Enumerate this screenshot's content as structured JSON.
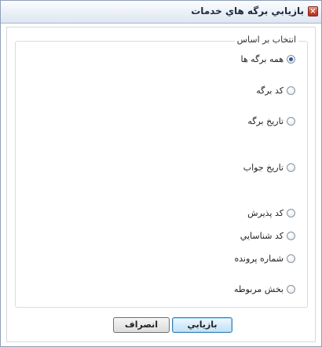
{
  "window": {
    "title": "بازيابي برگه هاي خدمات",
    "close_glyph": "×"
  },
  "group": {
    "legend": "انتخاب بر اساس",
    "options": [
      {
        "label": "همه برگه ها",
        "checked": true
      },
      {
        "label": "کد برگه",
        "checked": false
      },
      {
        "label": "تاريخ برگه",
        "checked": false
      },
      {
        "label": "تاريخ جواب",
        "checked": false
      },
      {
        "label": "کد پذيرش",
        "checked": false
      },
      {
        "label": "کد شناسايي",
        "checked": false
      },
      {
        "label": "شماره پرونده",
        "checked": false
      },
      {
        "label": "بخش مربوطه",
        "checked": false
      }
    ]
  },
  "buttons": {
    "refresh_label": "بازيابي",
    "cancel_label": "انصراف"
  },
  "colors": {
    "accent": "#2e5a9a",
    "close_button": "#c7432a",
    "default_button_border": "#3c7fb1"
  }
}
